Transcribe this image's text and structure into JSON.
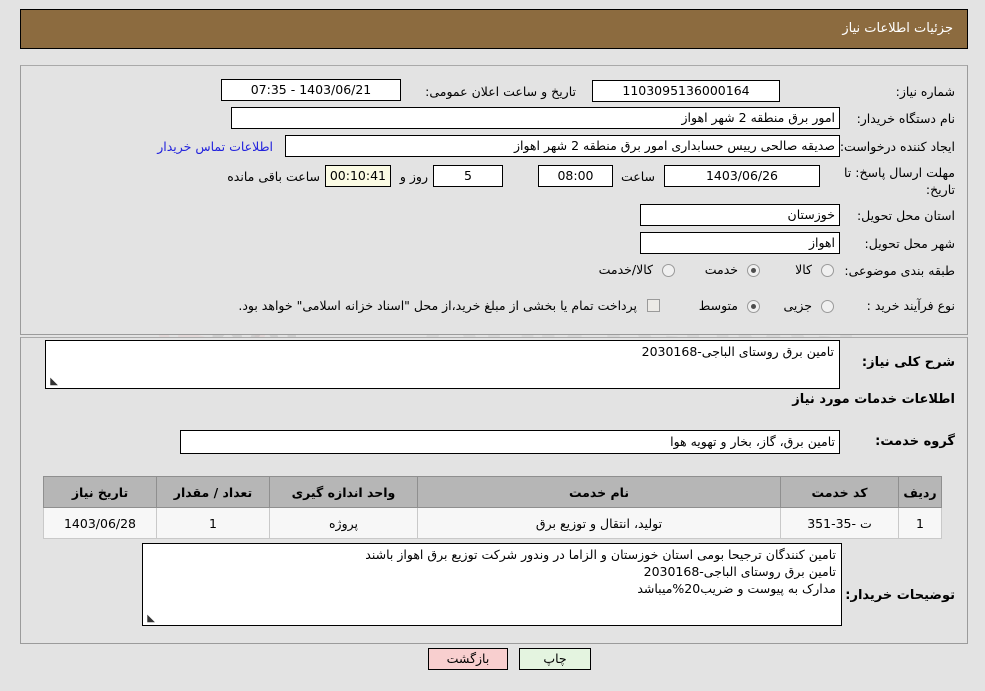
{
  "header": {
    "title": "جزئیات اطلاعات نیاز"
  },
  "top_section": {
    "need_number_label": "شماره نیاز:",
    "need_number_value": "1103095136000164",
    "announce_datetime_label": "تاریخ و ساعت اعلان عمومی:",
    "announce_datetime_value": "1403/06/21 - 07:35",
    "buyer_org_label": "نام دستگاه خریدار:",
    "buyer_org_value": "امور برق منطقه 2 شهر اهواز",
    "requester_label": "ایجاد کننده درخواست:",
    "requester_value": "صدیقه صالحی رییس حسابداری امور برق منطقه 2 شهر اهواز",
    "contact_link": "اطلاعات تماس خریدار",
    "deadline_label_line1": "مهلت ارسال پاسخ: تا",
    "deadline_label_line2": "تاریخ:",
    "deadline_date": "1403/06/26",
    "deadline_time_label": "ساعت",
    "deadline_time": "08:00",
    "remaining_days": "5",
    "remaining_days_label": "روز و",
    "remaining_time": "00:10:41",
    "remaining_time_label": "ساعت باقی مانده",
    "province_label": "استان محل تحویل:",
    "province_value": "خوزستان",
    "city_label": "شهر محل تحویل:",
    "city_value": "اهواز",
    "category_label": "طبقه بندی موضوعی:",
    "category_options": [
      {
        "label": "کالا",
        "selected": false
      },
      {
        "label": "خدمت",
        "selected": true
      },
      {
        "label": "کالا/خدمت",
        "selected": false
      }
    ],
    "process_label": "نوع فرآیند خرید :",
    "process_options": [
      {
        "label": "جزیی",
        "selected": false
      },
      {
        "label": "متوسط",
        "selected": true
      }
    ],
    "treasury_checkbox_label": "پرداخت تمام یا بخشی از مبلغ خرید،از محل \"اسناد خزانه اسلامی\" خواهد بود.",
    "treasury_checkbox_checked": false
  },
  "bottom_section": {
    "general_desc_label": "شرح کلی نیاز:",
    "general_desc_value": "تامین برق روستای الباجی-2030168",
    "services_info_title": "اطلاعات خدمات مورد نیاز",
    "service_group_label": "گروه خدمت:",
    "service_group_value": "تامین برق، گاز، بخار و تهویه هوا",
    "buyer_notes_label": "توضیحات خریدار:",
    "buyer_notes_value": "تامین کنندگان ترجیحا بومی استان خوزستان و الزاما در وندور شرکت توزیع برق اهواز باشند\nتامین برق روستای الباجی-2030168\nمدارک به پیوست و ضریب20%میباشد"
  },
  "table": {
    "columns": [
      "ردیف",
      "کد خدمت",
      "نام خدمت",
      "واحد اندازه گیری",
      "تعداد / مقدار",
      "تاریخ نیاز"
    ],
    "rows": [
      {
        "row_no": "1",
        "service_code": "ت -35-351",
        "service_name": "تولید، انتقال و توزیع برق",
        "unit": "پروژه",
        "quantity": "1",
        "need_date": "1403/06/28"
      }
    ]
  },
  "footer": {
    "back_button": "بازگشت",
    "print_button": "چاپ"
  },
  "colors": {
    "header_brown": "#8c6b3f",
    "page_background": "#e3e3e3",
    "link_blue": "#2222dd",
    "table_header": "#b6b6b6",
    "back_button": "#f8cfcf",
    "print_button": "#e4f4e0",
    "highlight_yellow": "#fbfbe4"
  },
  "watermark": {
    "text": "AriaTender",
    "suffix": ".net"
  }
}
